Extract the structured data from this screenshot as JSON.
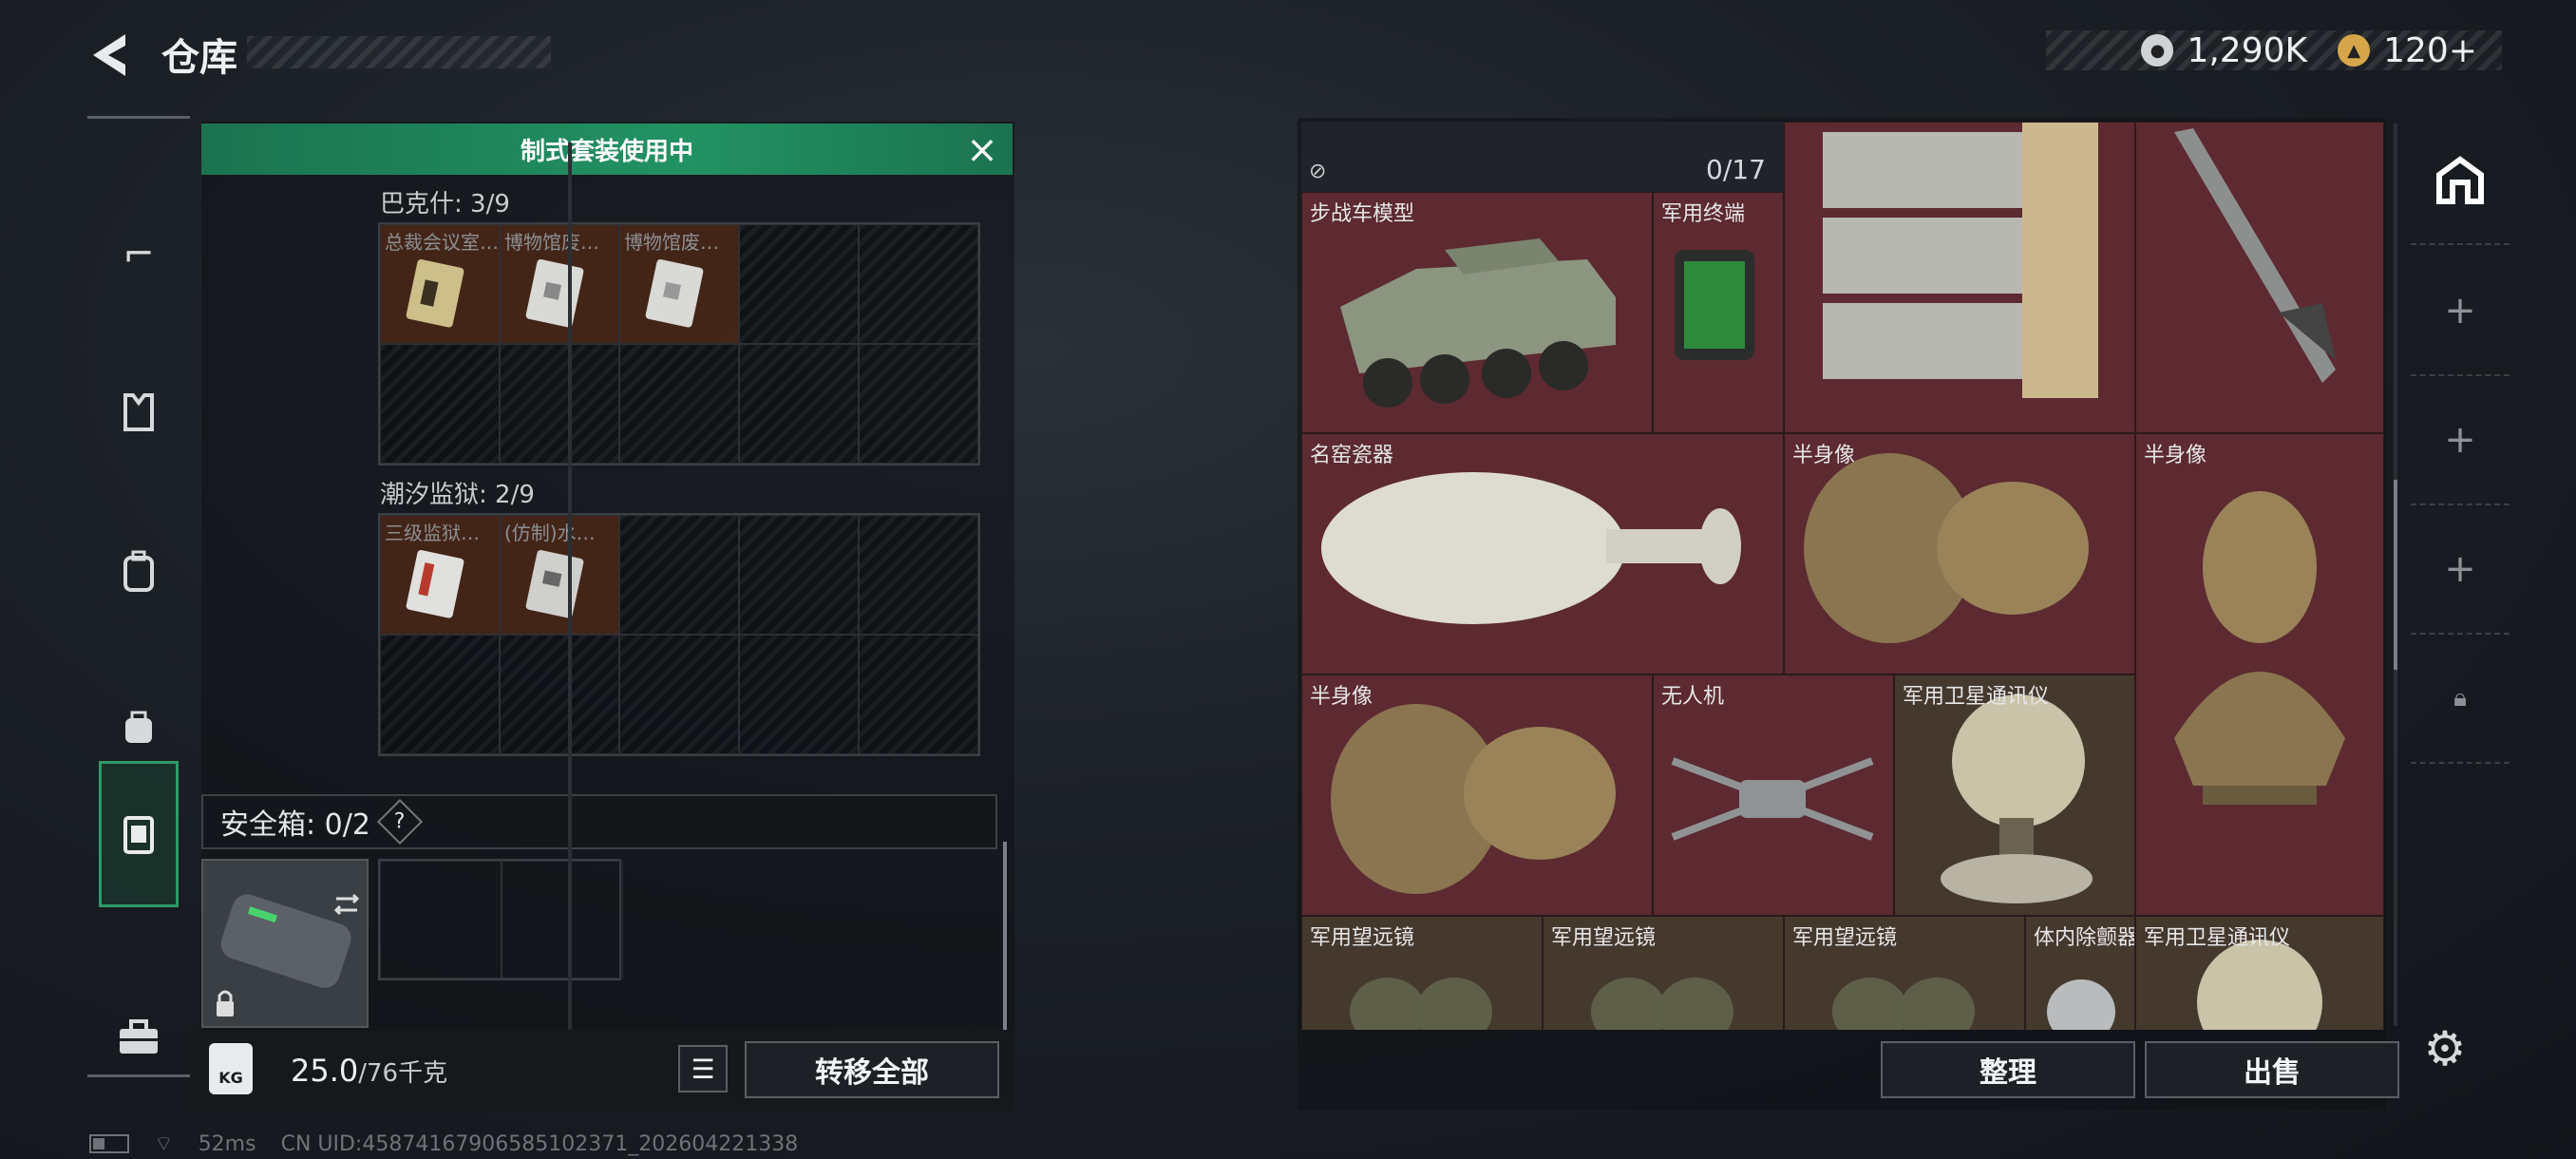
{
  "header": {
    "title": "仓库",
    "back_icon": "back-arrow-icon"
  },
  "currency": [
    {
      "icon": "silver-coin-icon",
      "value": "1,290K",
      "color": "#cfd3d6"
    },
    {
      "icon": "gold-coin-icon",
      "value": "120+",
      "color": "#d7a64a"
    }
  ],
  "left_rail": [
    {
      "icon": "gun-icon"
    },
    {
      "icon": "vest-icon"
    },
    {
      "icon": "backpack-icon"
    },
    {
      "icon": "pouch-icon"
    },
    {
      "icon": "safe-box-icon",
      "active": true
    },
    {
      "icon": "toolbox-icon"
    }
  ],
  "left_panel": {
    "banner": "制式套装使用中",
    "sections": [
      {
        "title": "巴克什: 3/9",
        "items": [
          "总裁会议室…",
          "博物馆废…",
          "博物馆废…"
        ]
      },
      {
        "title": "潮汐监狱: 2/9",
        "items": [
          "三级监狱…",
          "(仿制)水…"
        ]
      }
    ],
    "safe_box_label": "安全箱: 0/2",
    "help": "?",
    "weight_value": "25.0",
    "weight_total": "/76千克",
    "transfer_all": "转移全部"
  },
  "right_panel": {
    "counter": "0/17",
    "items": [
      "步战车模型",
      "军用终端",
      "名窑瓷器",
      "半身像",
      "半身像",
      "半身像",
      "无人机",
      "军用卫星通讯仪",
      "军用卫星通讯仪",
      "军用望远镜",
      "军用望远镜",
      "军用望远镜",
      "体内除颤器"
    ],
    "sort_label": "整理",
    "sell_label": "出售"
  },
  "status_bar": {
    "ping": "52ms",
    "uid": "CN UID:4587416790658510237​1_202604221338"
  },
  "colors": {
    "accent_green": "#229263",
    "cell_red": "#5c2a30",
    "cell_brown": "#45392e"
  }
}
